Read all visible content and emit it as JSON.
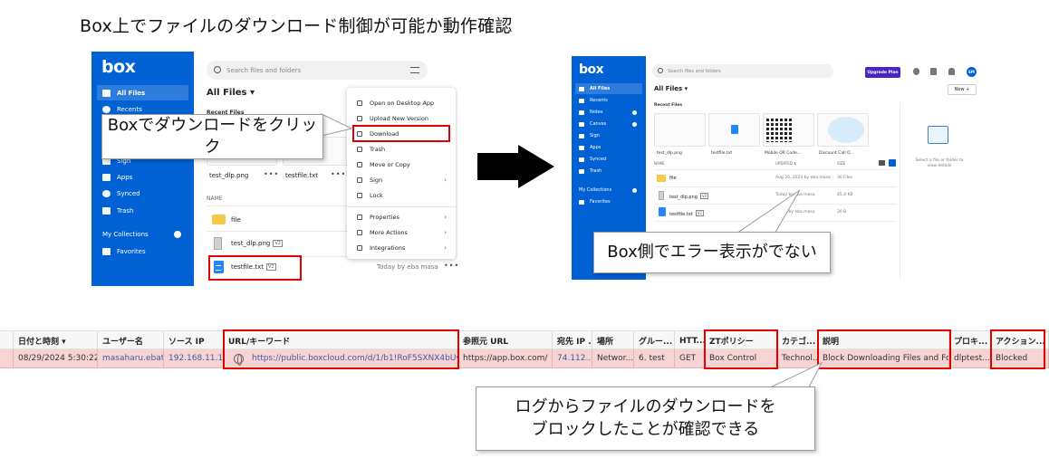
{
  "slide": {
    "title": "Box上でファイルのダウンロード制御が可能か動作確認"
  },
  "callouts": {
    "click_download": "Boxでダウンロードをクリック",
    "no_error": "Box側でエラー表示がでない",
    "log_line1": "ログからファイルのダウンロードを",
    "log_line2": "ブロックしたことが確認できる"
  },
  "box_left": {
    "logo": "box",
    "search_placeholder": "Search files and folders",
    "page_title": "All Files ▾",
    "recent_heading": "Recent Files",
    "sidebar": [
      {
        "label": "All Files",
        "icon": "folder-icon"
      },
      {
        "label": "Recents",
        "icon": "clock-icon"
      },
      {
        "label": "Sign",
        "icon": "pen-icon"
      },
      {
        "label": "Apps",
        "icon": "apps-icon"
      },
      {
        "label": "Synced",
        "icon": "check-circle-icon"
      },
      {
        "label": "Trash",
        "icon": "trash-icon"
      }
    ],
    "collections_label": "My Collections",
    "favorites_label": "Favorites",
    "thumbs": [
      {
        "name": "test_dlp.png"
      },
      {
        "name": "testfile.txt"
      }
    ],
    "list_header": "NAME",
    "rows": [
      {
        "name": "file",
        "version": ""
      },
      {
        "name": "test_dlp.png",
        "version": "V2"
      },
      {
        "name": "testfile.txt",
        "version": "V2",
        "meta": "Today by eba masa"
      }
    ],
    "more_label": "•••",
    "context_menu": [
      {
        "label": "Open on Desktop App",
        "icon": "desktop-icon"
      },
      {
        "label": "Upload New Version",
        "icon": "upload-icon"
      },
      {
        "label": "Download",
        "icon": "download-icon"
      },
      {
        "label": "Trash",
        "icon": "trash-icon"
      },
      {
        "label": "Move or Copy",
        "icon": "move-icon"
      },
      {
        "label": "Sign",
        "icon": "pen-icon",
        "submenu": true
      },
      {
        "label": "Lock",
        "icon": "lock-icon"
      },
      {
        "label": "Properties",
        "icon": "properties-icon",
        "submenu": true
      },
      {
        "label": "More Actions",
        "icon": "more-icon",
        "submenu": true
      },
      {
        "label": "Integrations",
        "icon": "integrations-icon",
        "submenu": true
      }
    ],
    "submenu_chevron": "›"
  },
  "box_right": {
    "logo": "box",
    "search_placeholder": "Search files and folders",
    "upgrade_label": "Upgrade Plan",
    "avatar": "EM",
    "page_title": "All Files ▾",
    "new_label": "New +",
    "recent_heading": "Recent Files",
    "sidebar": [
      {
        "label": "All Files"
      },
      {
        "label": "Recents"
      },
      {
        "label": "Notes"
      },
      {
        "label": "Canvas"
      },
      {
        "label": "Sign"
      },
      {
        "label": "Apps"
      },
      {
        "label": "Synced"
      },
      {
        "label": "Trash"
      }
    ],
    "collections_label": "My Collections",
    "favorites_label": "Favorites",
    "cards": [
      {
        "name": "test_dlp.png"
      },
      {
        "name": "testfile.txt"
      },
      {
        "name": "Mobile QR Code..."
      },
      {
        "name": "Discount Call O..."
      }
    ],
    "list_headers": {
      "name": "NAME",
      "updated": "UPDATED ⬇",
      "size": "SIZE"
    },
    "rows": [
      {
        "name": "file",
        "updated": "Aug 20, 2024 by eba masa",
        "size": "30 Files"
      },
      {
        "name": "test_dlp.png",
        "version": "V2",
        "updated": "Today by eba masa",
        "size": "45.4 KB"
      },
      {
        "name": "testfile.txt",
        "version": "V2",
        "updated": "Today by eba masa",
        "size": "26 B"
      }
    ],
    "details_hint": "Select a file or folder to view details"
  },
  "log": {
    "headers": [
      "日付と時刻 ▾",
      "ユーザー名",
      "ソース IP",
      "URL/キーワード",
      "参照元 URL",
      "宛先 IP ...",
      "場所",
      "グルー...",
      "HTT...",
      "ZTポリシー",
      "カテゴ...",
      "説明",
      "プロキ...",
      "アクション..."
    ],
    "row": [
      "08/29/2024 5:30:22 ...",
      "masaharu.ebat...",
      "192.168.11.131",
      "https://public.boxcloud.com/d/1/b1!RoF5SXNX4bUvbi3RIlL4y",
      "https://app.box.com/",
      "74.112....",
      "Networ...",
      "6. test",
      "GET",
      "Box Control",
      "Technol...",
      "Block Downloading Files and Folders",
      "dlptest....",
      "Blocked"
    ]
  },
  "colors": {
    "box_blue": "#0061d5",
    "highlight_red": "#e00000",
    "blocked_row": "#f8d3d3"
  }
}
